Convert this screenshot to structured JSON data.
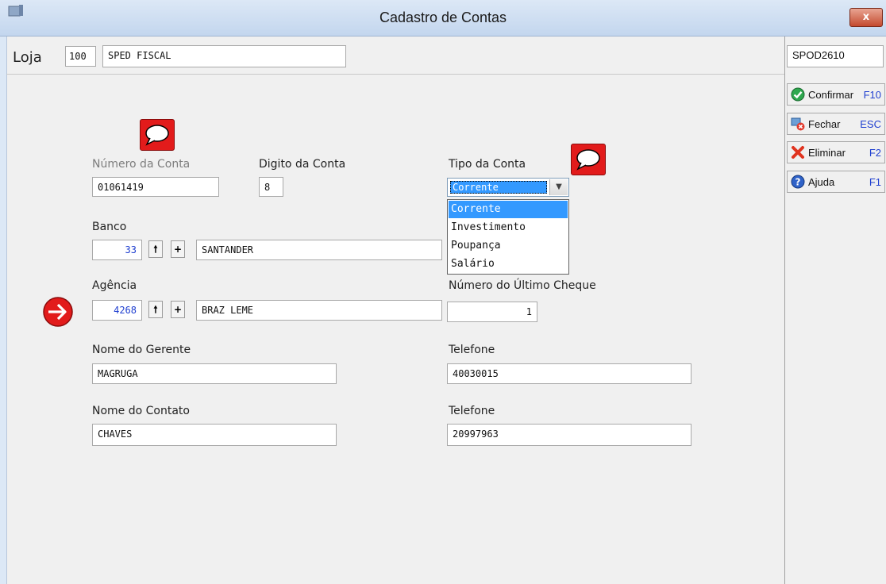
{
  "window": {
    "title": "Cadastro de Contas",
    "close_label": "x"
  },
  "header": {
    "loja_label": "Loja",
    "loja_code": "100",
    "loja_name": "SPED FISCAL",
    "program_code": "SPOD2610"
  },
  "sidebar": {
    "buttons": [
      {
        "label": "Confirmar",
        "key": "F10",
        "icon": "check-icon"
      },
      {
        "label": "Fechar",
        "key": "ESC",
        "icon": "close-window-icon"
      },
      {
        "label": "Eliminar",
        "key": "F2",
        "icon": "delete-x-icon"
      },
      {
        "label": "Ajuda",
        "key": "F1",
        "icon": "help-icon"
      }
    ]
  },
  "form": {
    "numero_conta_label": "Número da Conta",
    "numero_conta_value": "01061419",
    "digito_conta_label": "Digito da Conta",
    "digito_conta_value": "8",
    "tipo_conta_label": "Tipo da Conta",
    "tipo_conta_selected": "Corrente",
    "tipo_conta_options": [
      "Corrente",
      "Investimento",
      "Poupança",
      "Salário"
    ],
    "banco_label": "Banco",
    "banco_code": "33",
    "banco_name": "SANTANDER",
    "agencia_label": "Agência",
    "agencia_code": "4268",
    "agencia_name": "BRAZ LEME",
    "ultimo_cheque_label": "Número do Último Cheque",
    "ultimo_cheque_value": "1",
    "gerente_label": "Nome do Gerente",
    "gerente_value": "MAGRUGA",
    "telefone1_label": "Telefone",
    "telefone1_value": "40030015",
    "contato_label": "Nome do Contato",
    "contato_value": "CHAVES",
    "telefone2_label": "Telefone",
    "telefone2_value": "20997963",
    "up_symbol": "🠕",
    "plus_symbol": "+"
  },
  "colors": {
    "accent_blue": "#1f3fd0",
    "comment_red": "#e21b1b",
    "selection": "#3399ff"
  }
}
